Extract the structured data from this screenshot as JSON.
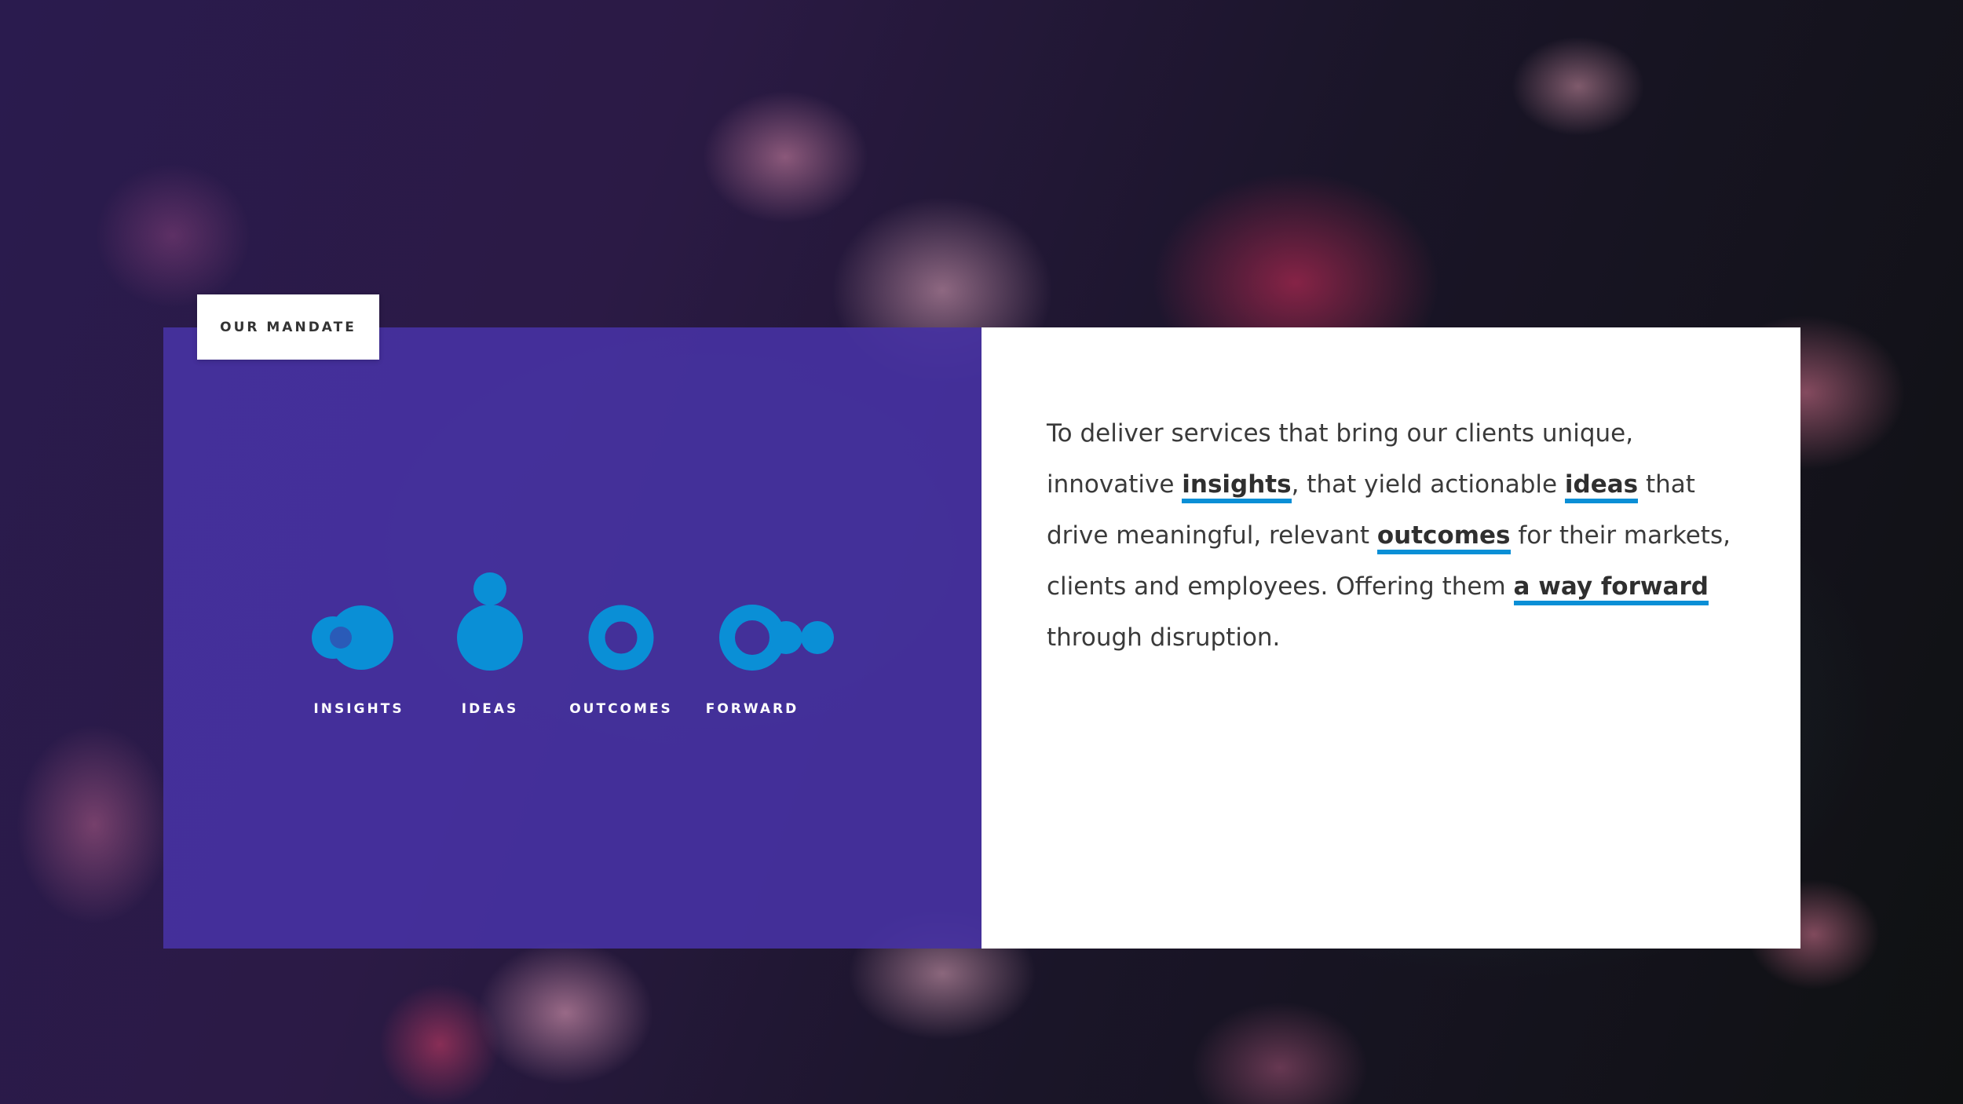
{
  "colors": {
    "panel_purple": "#4632a0",
    "accent_blue": "#0a8fd6",
    "label_white": "#ffffff",
    "body_text": "#3a3a3a"
  },
  "tag": {
    "label": "OUR MANDATE"
  },
  "pillars": [
    {
      "label": "INSIGHTS",
      "icon": "insights-icon"
    },
    {
      "label": "IDEAS",
      "icon": "ideas-icon"
    },
    {
      "label": "OUTCOMES",
      "icon": "outcomes-icon"
    },
    {
      "label": "FORWARD",
      "icon": "forward-icon"
    }
  ],
  "mandate": {
    "part1": "To deliver services that bring our clients unique, innovative ",
    "kw1": "insights",
    "part2": ", that yield actionable ",
    "kw2": "ideas",
    "part3": " that drive meaningful, relevant ",
    "kw3": "outcomes",
    "part4": " for their markets, clients and employees. Offering them ",
    "kw4": "a way forward",
    "part5": " through disruption."
  }
}
